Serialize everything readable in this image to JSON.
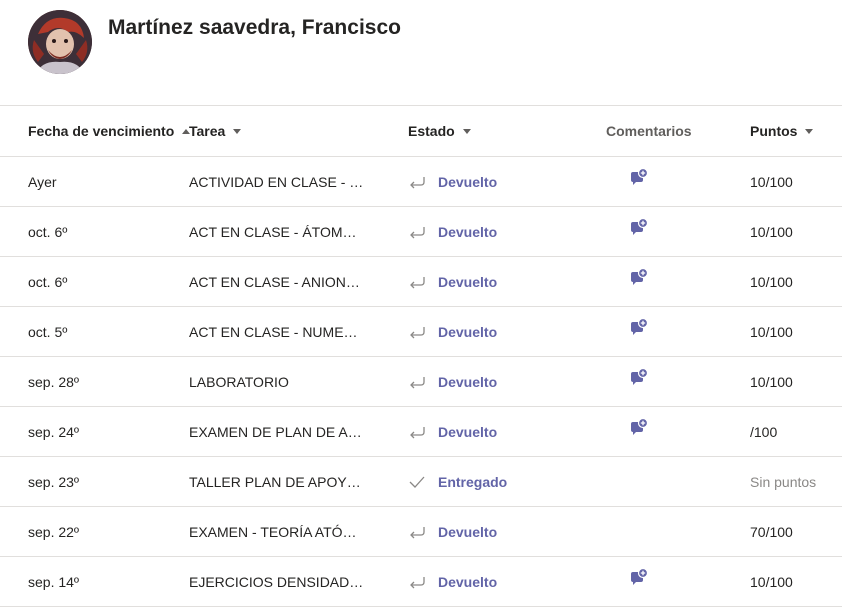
{
  "student": {
    "name": "Martínez saavedra, Francisco"
  },
  "table": {
    "headers": {
      "due_date": "Fecha de vencimiento",
      "task": "Tarea",
      "status": "Estado",
      "comments": "Comentarios",
      "points": "Puntos"
    },
    "rows": [
      {
        "due": "Ayer",
        "task": "ACTIVIDAD EN CLASE - C...",
        "status": "Devuelto",
        "status_icon": "return-arrow-icon",
        "has_comment": true,
        "points": "10/100"
      },
      {
        "due": "oct. 6º",
        "task": "ACT EN CLASE - ÁTOMOS ...",
        "status": "Devuelto",
        "status_icon": "return-arrow-icon",
        "has_comment": true,
        "points": "10/100"
      },
      {
        "due": "oct. 6º",
        "task": "ACT EN CLASE - ANIONES...",
        "status": "Devuelto",
        "status_icon": "return-arrow-icon",
        "has_comment": true,
        "points": "10/100"
      },
      {
        "due": "oct. 5º",
        "task": "ACT EN CLASE - NUMERO...",
        "status": "Devuelto",
        "status_icon": "return-arrow-icon",
        "has_comment": true,
        "points": "10/100"
      },
      {
        "due": "sep. 28º",
        "task": "LABORATORIO",
        "status": "Devuelto",
        "status_icon": "return-arrow-icon",
        "has_comment": true,
        "points": "10/100"
      },
      {
        "due": "sep. 24º",
        "task": "EXAMEN DE PLAN DE AP...",
        "status": "Devuelto",
        "status_icon": "return-arrow-icon",
        "has_comment": true,
        "points": "/100"
      },
      {
        "due": "sep. 23º",
        "task": "TALLER PLAN DE APOYO 3...",
        "status": "Entregado",
        "status_icon": "checkmark-icon",
        "has_comment": false,
        "points": "Sin puntos",
        "points_muted": true
      },
      {
        "due": "sep. 22º",
        "task": "EXAMEN - TEORÍA ATÓMI...",
        "status": "Devuelto",
        "status_icon": "return-arrow-icon",
        "has_comment": false,
        "points": "70/100"
      },
      {
        "due": "sep. 14º",
        "task": "EJERCICIOS DENSIDAD - 1...",
        "status": "Devuelto",
        "status_icon": "return-arrow-icon",
        "has_comment": true,
        "points": "10/100"
      }
    ]
  },
  "colors": {
    "accent": "#6264a7",
    "text": "#252423",
    "muted": "#8a8886",
    "divider": "#e1dfdd"
  }
}
